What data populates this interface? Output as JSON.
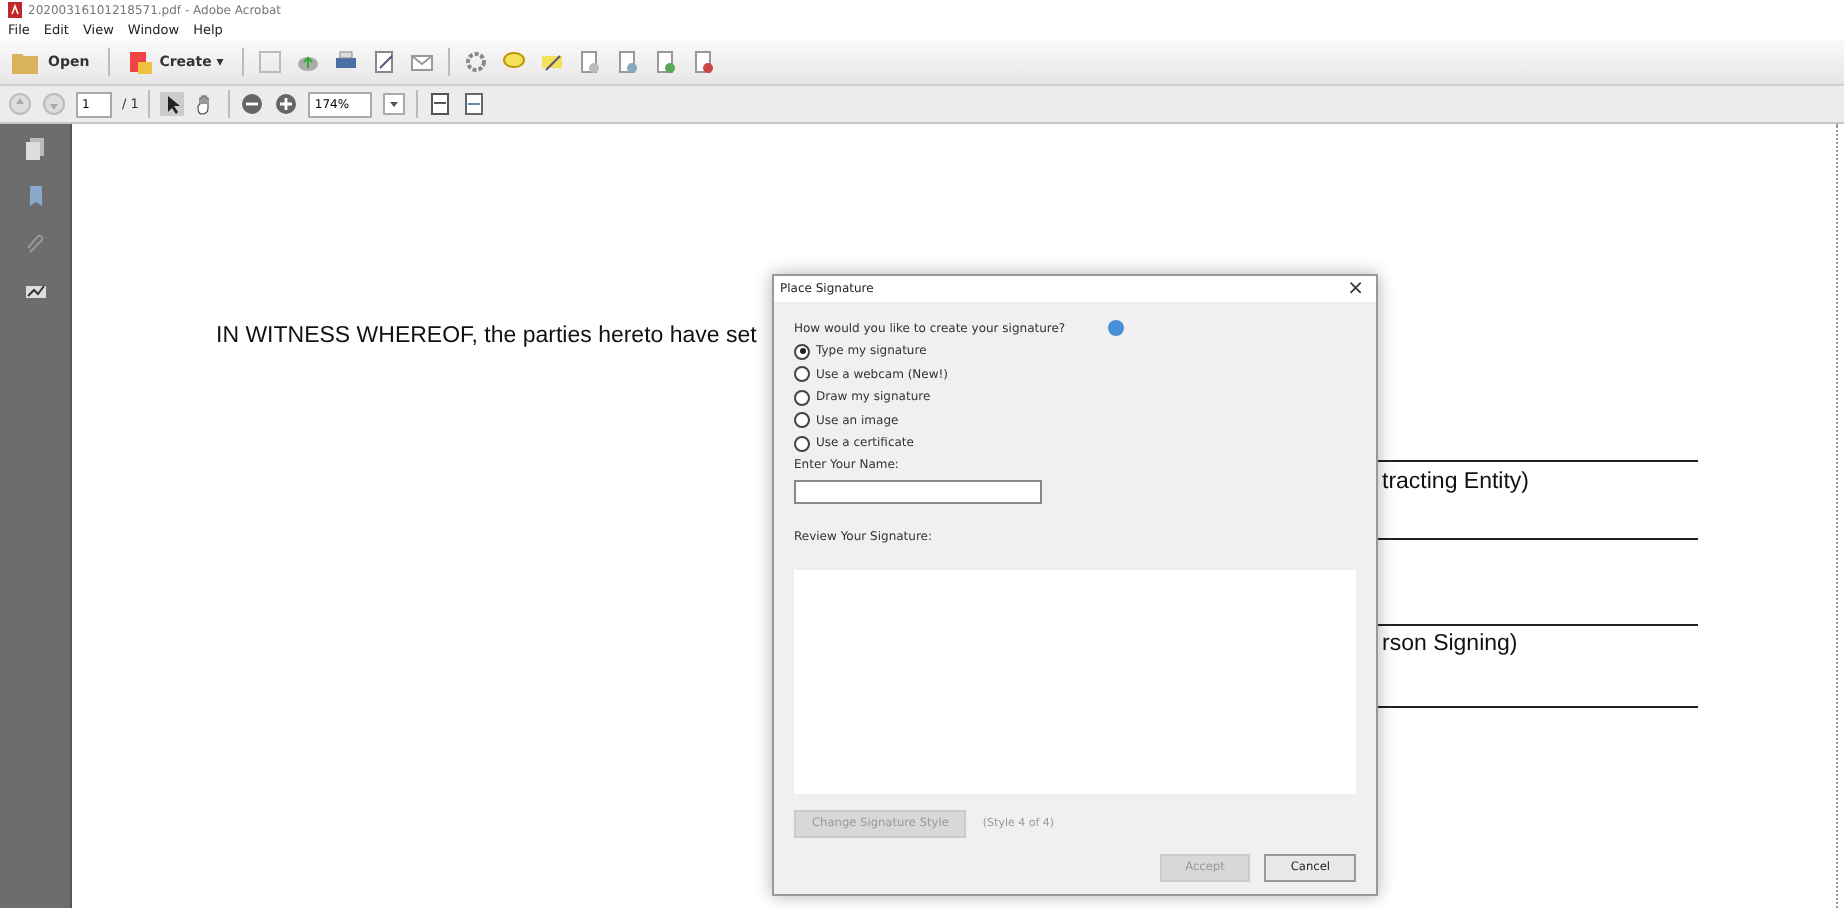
{
  "window": {
    "title": "20200316101218571.pdf - Adobe Acrobat"
  },
  "menu": [
    "File",
    "Edit",
    "View",
    "Window",
    "Help"
  ],
  "toolbar": {
    "open": "Open",
    "create": "Create",
    "create_caret": "▾"
  },
  "nav": {
    "page": "1",
    "page_count": "/ 1",
    "zoom": "174%"
  },
  "document": {
    "witness": "IN WITNESS WHEREOF, the parties hereto have set",
    "entity": "tracting Entity)",
    "signing": "rson Signing)"
  },
  "dialog": {
    "title": "Place Signature",
    "close": "×",
    "question": "How would you like to create your signature?",
    "options": [
      {
        "label": "Type my signature",
        "selected": true
      },
      {
        "label": "Use a webcam (New!)",
        "selected": false
      },
      {
        "label": "Draw my signature",
        "selected": false
      },
      {
        "label": "Use an image",
        "selected": false
      },
      {
        "label": "Use a certificate",
        "selected": false
      }
    ],
    "name_label": "Enter Your Name:",
    "review_label": "Review Your Signature:",
    "change_style": {
      "label": "Change Signature Style",
      "disabled": true
    },
    "style_count": "(Style 4 of 4)",
    "accept": {
      "label": "Accept",
      "disabled": true
    },
    "cancel": {
      "label": "Cancel",
      "disabled": false
    }
  }
}
